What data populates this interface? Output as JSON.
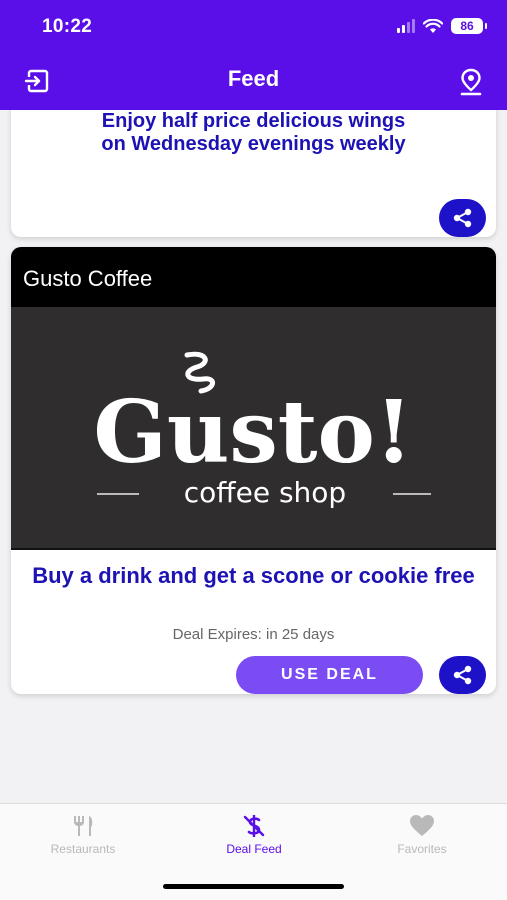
{
  "status_bar": {
    "time": "10:22",
    "battery": "86"
  },
  "header": {
    "title": "Feed",
    "left_icon": "logout-icon",
    "right_icon": "location-pin-icon"
  },
  "feed": {
    "cards": [
      {
        "promo": "Enjoy half price delicious wings on Wednesday evenings weekly",
        "share_icon": "share-icon"
      },
      {
        "restaurant": "Gusto Coffee",
        "logo_text": {
          "main": "Gusto!",
          "sub": "coffee shop"
        },
        "promo": "Buy a drink and get a scone or cookie free",
        "expires": "Deal Expires: in 25 days",
        "use_deal_label": "USE DEAL",
        "share_icon": "share-icon"
      }
    ]
  },
  "tabbar": {
    "tabs": [
      {
        "label": "Restaurants",
        "icon": "fork-knife-icon",
        "active": false
      },
      {
        "label": "Deal Feed",
        "icon": "dollar-icon",
        "active": true
      },
      {
        "label": "Favorites",
        "icon": "heart-icon",
        "active": false
      }
    ]
  },
  "colors": {
    "header": "#5b0fe8",
    "promo_text": "#1d12b4",
    "share_button": "#1d12c8",
    "use_deal_button": "#7b4cf4",
    "inactive_tab": "#b9b9b9"
  }
}
